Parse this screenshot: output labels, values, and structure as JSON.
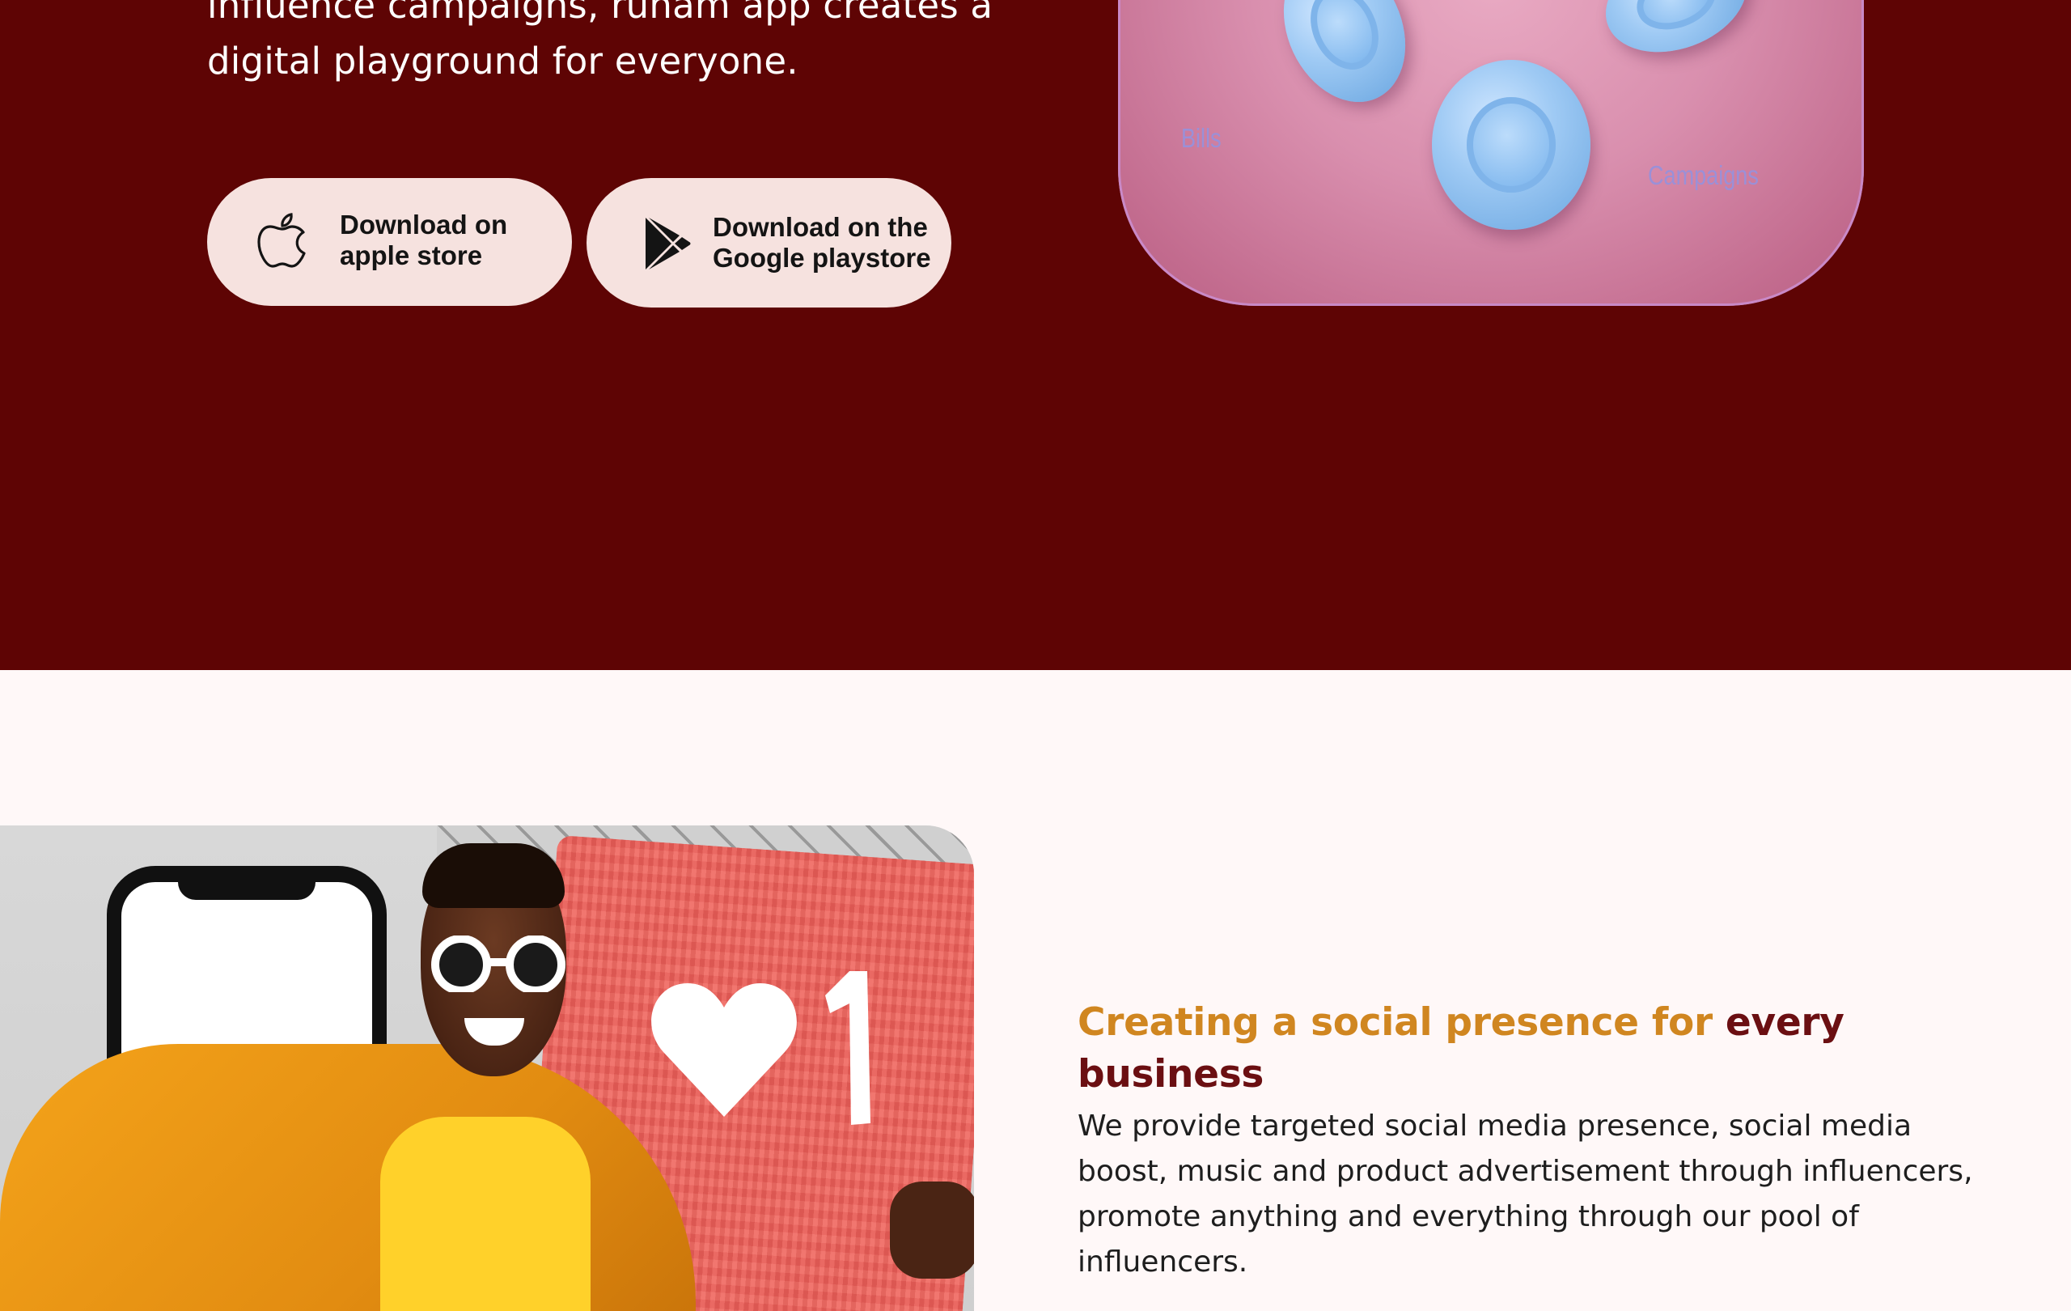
{
  "hero": {
    "intro_lines": [
      "influence campaigns, runam app creates a",
      "digital playground for everyone."
    ],
    "apple_button": {
      "line1": "Download on",
      "line2": "apple store",
      "icon": "apple-icon"
    },
    "google_button": {
      "line1": "Download on the",
      "line2": "Google playstore",
      "icon": "google-play-icon"
    },
    "showcase": {
      "labels": {
        "bills": "Bills",
        "campaigns": "Campaigns"
      }
    }
  },
  "feature": {
    "title_accent": "Creating a social presence for",
    "title_dark_word": "every",
    "title_dark_line2": "business",
    "body_lines": [
      "We provide targeted social media presence, social media",
      "boost, music and product advertisement through influencers,",
      "promote anything and everything through our pool of",
      "influencers."
    ]
  },
  "colors": {
    "hero_bg": "#5e0404",
    "page_bg": "#fff8f8",
    "button_bg": "#f6e2df",
    "accent_gold": "#d08620",
    "accent_maroon": "#6b0f12"
  }
}
